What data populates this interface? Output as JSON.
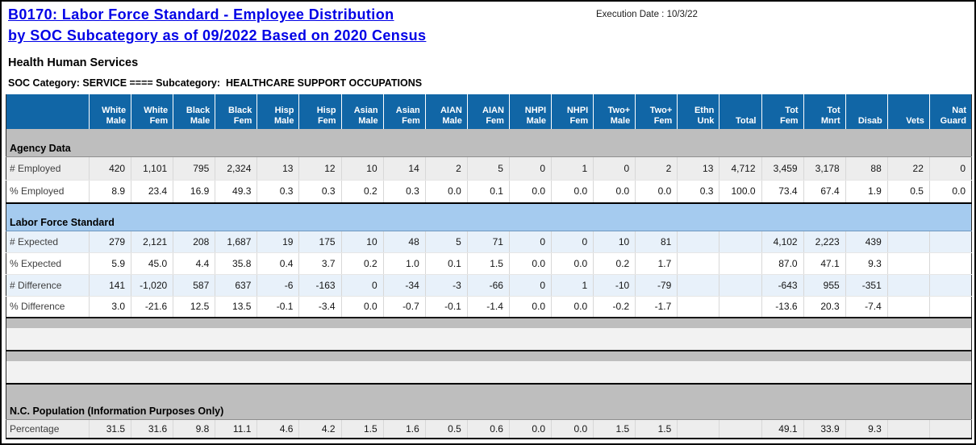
{
  "header": {
    "title_line1": "B0170: Labor Force Standard - Employee Distribution",
    "title_line2": "by SOC Subcategory as of 09/2022 Based on 2020 Census",
    "execution_date": "Execution Date : 10/3/22",
    "agency_name": "Health Human Services",
    "soc_category_line": "SOC Category: SERVICE ==== Subcategory:  HEALTHCARE SUPPORT OCCUPATIONS"
  },
  "colors": {
    "title_link": "#0000E6",
    "table_header_bg": "#1166A6",
    "section_gray_band": "#BEBEBE",
    "section_blue_band": "#A5CBEF",
    "shaded_row_gray": "#EDEDED",
    "shaded_row_blue": "#E8F1FA",
    "blank_row_light": "#F2F2F2"
  },
  "table": {
    "columns": [
      {
        "line1": "White",
        "line2": "Male"
      },
      {
        "line1": "White",
        "line2": "Fem"
      },
      {
        "line1": "Black",
        "line2": "Male"
      },
      {
        "line1": "Black",
        "line2": "Fem"
      },
      {
        "line1": "Hisp",
        "line2": "Male"
      },
      {
        "line1": "Hisp",
        "line2": "Fem"
      },
      {
        "line1": "Asian",
        "line2": "Male"
      },
      {
        "line1": "Asian",
        "line2": "Fem"
      },
      {
        "line1": "AIAN",
        "line2": "Male"
      },
      {
        "line1": "AIAN",
        "line2": "Fem"
      },
      {
        "line1": "NHPI",
        "line2": "Male"
      },
      {
        "line1": "NHPI",
        "line2": "Fem"
      },
      {
        "line1": "Two+",
        "line2": "Male"
      },
      {
        "line1": "Two+",
        "line2": "Fem"
      },
      {
        "line1": "Ethn",
        "line2": "Unk"
      },
      {
        "line1": "",
        "line2": "Total"
      },
      {
        "line1": "Tot",
        "line2": "Fem"
      },
      {
        "line1": "Tot",
        "line2": "Mnrt"
      },
      {
        "line1": "",
        "line2": "Disab"
      },
      {
        "line1": "",
        "line2": "Vets"
      },
      {
        "line1": "Nat",
        "line2": "Guard"
      }
    ],
    "sections": [
      {
        "kind": "data",
        "name": "agency-data",
        "label": "Agency Data",
        "band": "gray",
        "row_height_class": "h29",
        "rows": [
          {
            "label": "# Employed",
            "shaded": true,
            "values": [
              "420",
              "1,101",
              "795",
              "2,324",
              "13",
              "12",
              "10",
              "14",
              "2",
              "5",
              "0",
              "1",
              "0",
              "2",
              "13",
              "4,712",
              "3,459",
              "3,178",
              "88",
              "22",
              "0"
            ]
          },
          {
            "label": "% Employed",
            "shaded": false,
            "values": [
              "8.9",
              "23.4",
              "16.9",
              "49.3",
              "0.3",
              "0.3",
              "0.2",
              "0.3",
              "0.0",
              "0.1",
              "0.0",
              "0.0",
              "0.0",
              "0.0",
              "0.3",
              "100.0",
              "73.4",
              "67.4",
              "1.9",
              "0.5",
              "0.0"
            ]
          }
        ]
      },
      {
        "kind": "data",
        "name": "labor-force-standard",
        "label": "Labor Force Standard",
        "band": "blue",
        "row_height_class": "h27",
        "rows": [
          {
            "label": "# Expected",
            "shaded": true,
            "values": [
              "279",
              "2,121",
              "208",
              "1,687",
              "19",
              "175",
              "10",
              "48",
              "5",
              "71",
              "0",
              "0",
              "10",
              "81",
              "",
              "",
              "4,102",
              "2,223",
              "439",
              "",
              ""
            ]
          },
          {
            "label": "% Expected",
            "shaded": false,
            "values": [
              "5.9",
              "45.0",
              "4.4",
              "35.8",
              "0.4",
              "3.7",
              "0.2",
              "1.0",
              "0.1",
              "1.5",
              "0.0",
              "0.0",
              "0.2",
              "1.7",
              "",
              "",
              "87.0",
              "47.1",
              "9.3",
              "",
              ""
            ]
          },
          {
            "label": "# Difference",
            "shaded": true,
            "values": [
              "141",
              "-1,020",
              "587",
              "637",
              "-6",
              "-163",
              "0",
              "-34",
              "-3",
              "-66",
              "0",
              "1",
              "-10",
              "-79",
              "",
              "",
              "-643",
              "955",
              "-351",
              "",
              ""
            ]
          },
          {
            "label": "% Difference",
            "shaded": false,
            "values": [
              "3.0",
              "-21.6",
              "12.5",
              "13.5",
              "-0.1",
              "-3.4",
              "0.0",
              "-0.7",
              "-0.1",
              "-1.4",
              "0.0",
              "0.0",
              "-0.2",
              "-1.7",
              "",
              "",
              "-13.6",
              "20.3",
              "-7.4",
              "",
              ""
            ]
          }
        ]
      },
      {
        "kind": "spacer",
        "name": "spacer-1"
      },
      {
        "kind": "spacer",
        "name": "spacer-2"
      },
      {
        "kind": "data",
        "name": "nc-population",
        "label": "N.C. Population (Information Purposes Only)",
        "band": "gray-tall",
        "row_height_class": "h24",
        "rows": [
          {
            "label": "Percentage",
            "shaded": true,
            "values": [
              "31.5",
              "31.6",
              "9.8",
              "11.1",
              "4.6",
              "4.2",
              "1.5",
              "1.6",
              "0.5",
              "0.6",
              "0.0",
              "0.0",
              "1.5",
              "1.5",
              "",
              "",
              "49.1",
              "33.9",
              "9.3",
              "",
              ""
            ]
          }
        ]
      }
    ]
  }
}
